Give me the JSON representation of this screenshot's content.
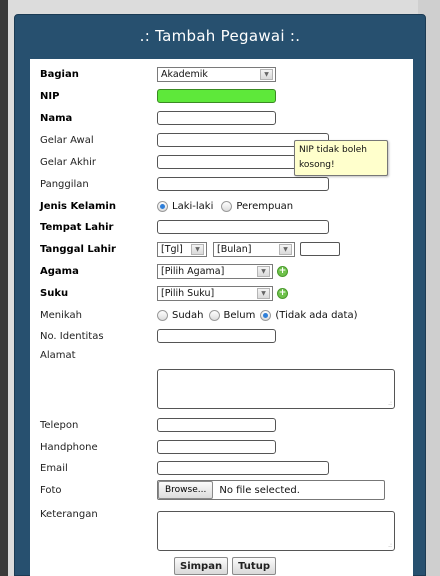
{
  "modal": {
    "title": ".: Tambah Pegawai :."
  },
  "form": {
    "bagian": {
      "label": "Bagian",
      "value": "Akademik"
    },
    "nip": {
      "label": "NIP",
      "value": ""
    },
    "nama": {
      "label": "Nama",
      "value": ""
    },
    "gelar_awal": {
      "label": "Gelar Awal",
      "value": ""
    },
    "gelar_akhir": {
      "label": "Gelar Akhir",
      "value": ""
    },
    "panggilan": {
      "label": "Panggilan",
      "value": ""
    },
    "jenis_kelamin": {
      "label": "Jenis Kelamin",
      "options": [
        "Laki-laki",
        "Perempuan"
      ],
      "selected": "Laki-laki"
    },
    "tempat_lahir": {
      "label": "Tempat Lahir",
      "value": ""
    },
    "tanggal_lahir": {
      "label": "Tanggal Lahir",
      "day": "[Tgl]",
      "month": "[Bulan]",
      "year": ""
    },
    "agama": {
      "label": "Agama",
      "value": "[Pilih Agama]"
    },
    "suku": {
      "label": "Suku",
      "value": "[Pilih Suku]"
    },
    "menikah": {
      "label": "Menikah",
      "options": [
        "Sudah",
        "Belum",
        "(Tidak ada data)"
      ],
      "selected": "(Tidak ada data)"
    },
    "no_identitas": {
      "label": "No. Identitas",
      "value": ""
    },
    "alamat": {
      "label": "Alamat",
      "value": ""
    },
    "telepon": {
      "label": "Telepon",
      "value": ""
    },
    "handphone": {
      "label": "Handphone",
      "value": ""
    },
    "email": {
      "label": "Email",
      "value": ""
    },
    "foto": {
      "label": "Foto",
      "browse_label": "Browse...",
      "file_text": "No file selected."
    },
    "keterangan": {
      "label": "Keterangan",
      "value": ""
    }
  },
  "tooltip": {
    "line1": "NIP tidak boleh",
    "line2": "kosong!"
  },
  "buttons": {
    "save": "Simpan",
    "close": "Tutup"
  },
  "icons": {
    "add_agama": "plus-circle-icon",
    "add_suku": "plus-circle-icon"
  },
  "colors": {
    "header": "#27506f",
    "nip_error": "#5ee83a",
    "tooltip_bg": "#ffffcc"
  }
}
